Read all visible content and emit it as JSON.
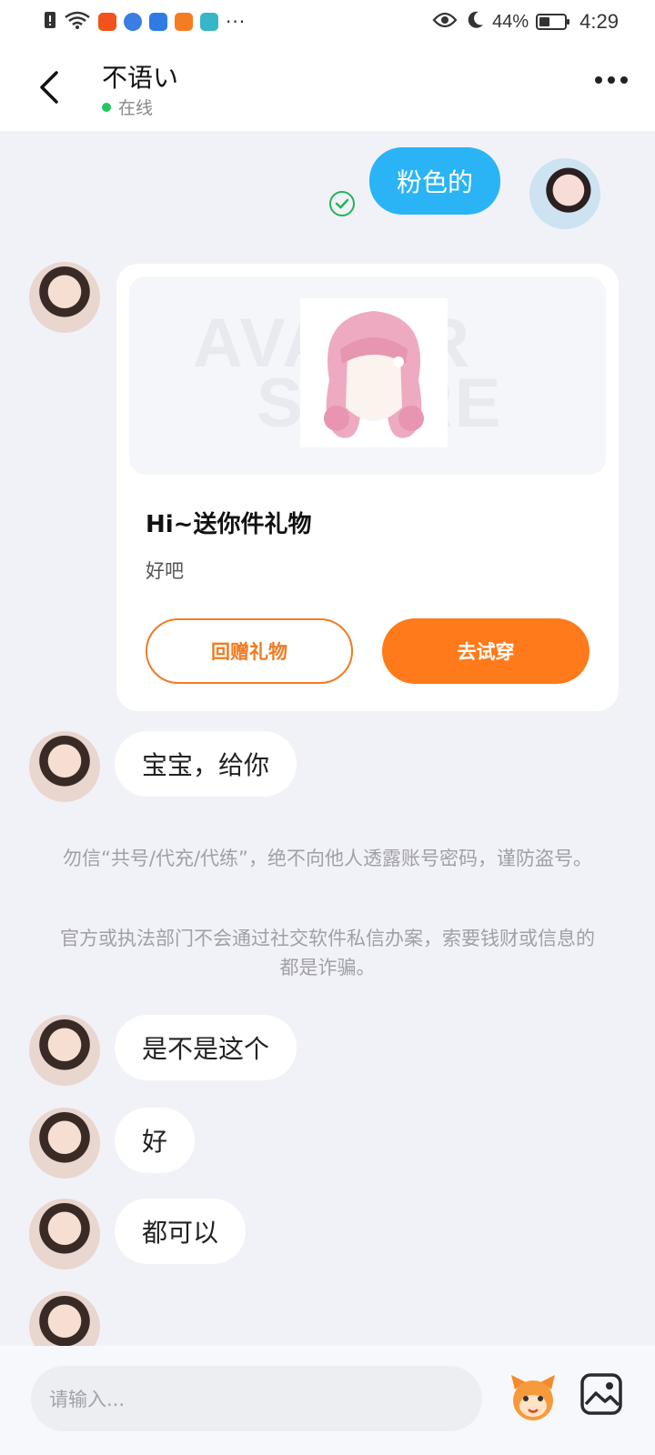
{
  "status_bar": {
    "battery": "44%",
    "time": "4:29",
    "battery_level": 0.44,
    "icons": [
      "sim-alert-icon",
      "wifi-icon",
      "app-icon-orange",
      "app-icon-blue",
      "app-icon-blue-2",
      "app-icon-orange-2",
      "app-icon-teal",
      "more-notifications-icon",
      "eye-icon",
      "moon-icon",
      "battery-icon"
    ],
    "more_dots": "···"
  },
  "header": {
    "title": "不语い",
    "status": "在线"
  },
  "messages": [
    {
      "sender": "me",
      "text": "粉色的",
      "read": true
    },
    {
      "sender": "them",
      "type": "gift_card"
    },
    {
      "sender": "them",
      "text": "宝宝，给你"
    },
    {
      "sender": "them",
      "text": "是不是这个"
    },
    {
      "sender": "them",
      "text": "好"
    },
    {
      "sender": "them",
      "text": "都可以"
    }
  ],
  "gift_card": {
    "watermark_line1": "AVATAR",
    "watermark_line2": "STORE",
    "title": "Hi~送你件礼物",
    "subtitle": "好吧",
    "return_gift_label": "回赠礼物",
    "try_on_label": "去试穿"
  },
  "notice": {
    "line1": "勿信“共号/代充/代练”，绝不向他人透露账号密码，谨防盗号。",
    "line2": "官方或执法部门不会通过社交软件私信办案，索要钱财或信息的都是诈骗。"
  },
  "input": {
    "placeholder": "请输入..."
  },
  "colors": {
    "accent_orange": "#ff7a1a",
    "my_bubble": "#2ab4f5",
    "online": "#22c55e",
    "background": "#f1f2f7"
  }
}
